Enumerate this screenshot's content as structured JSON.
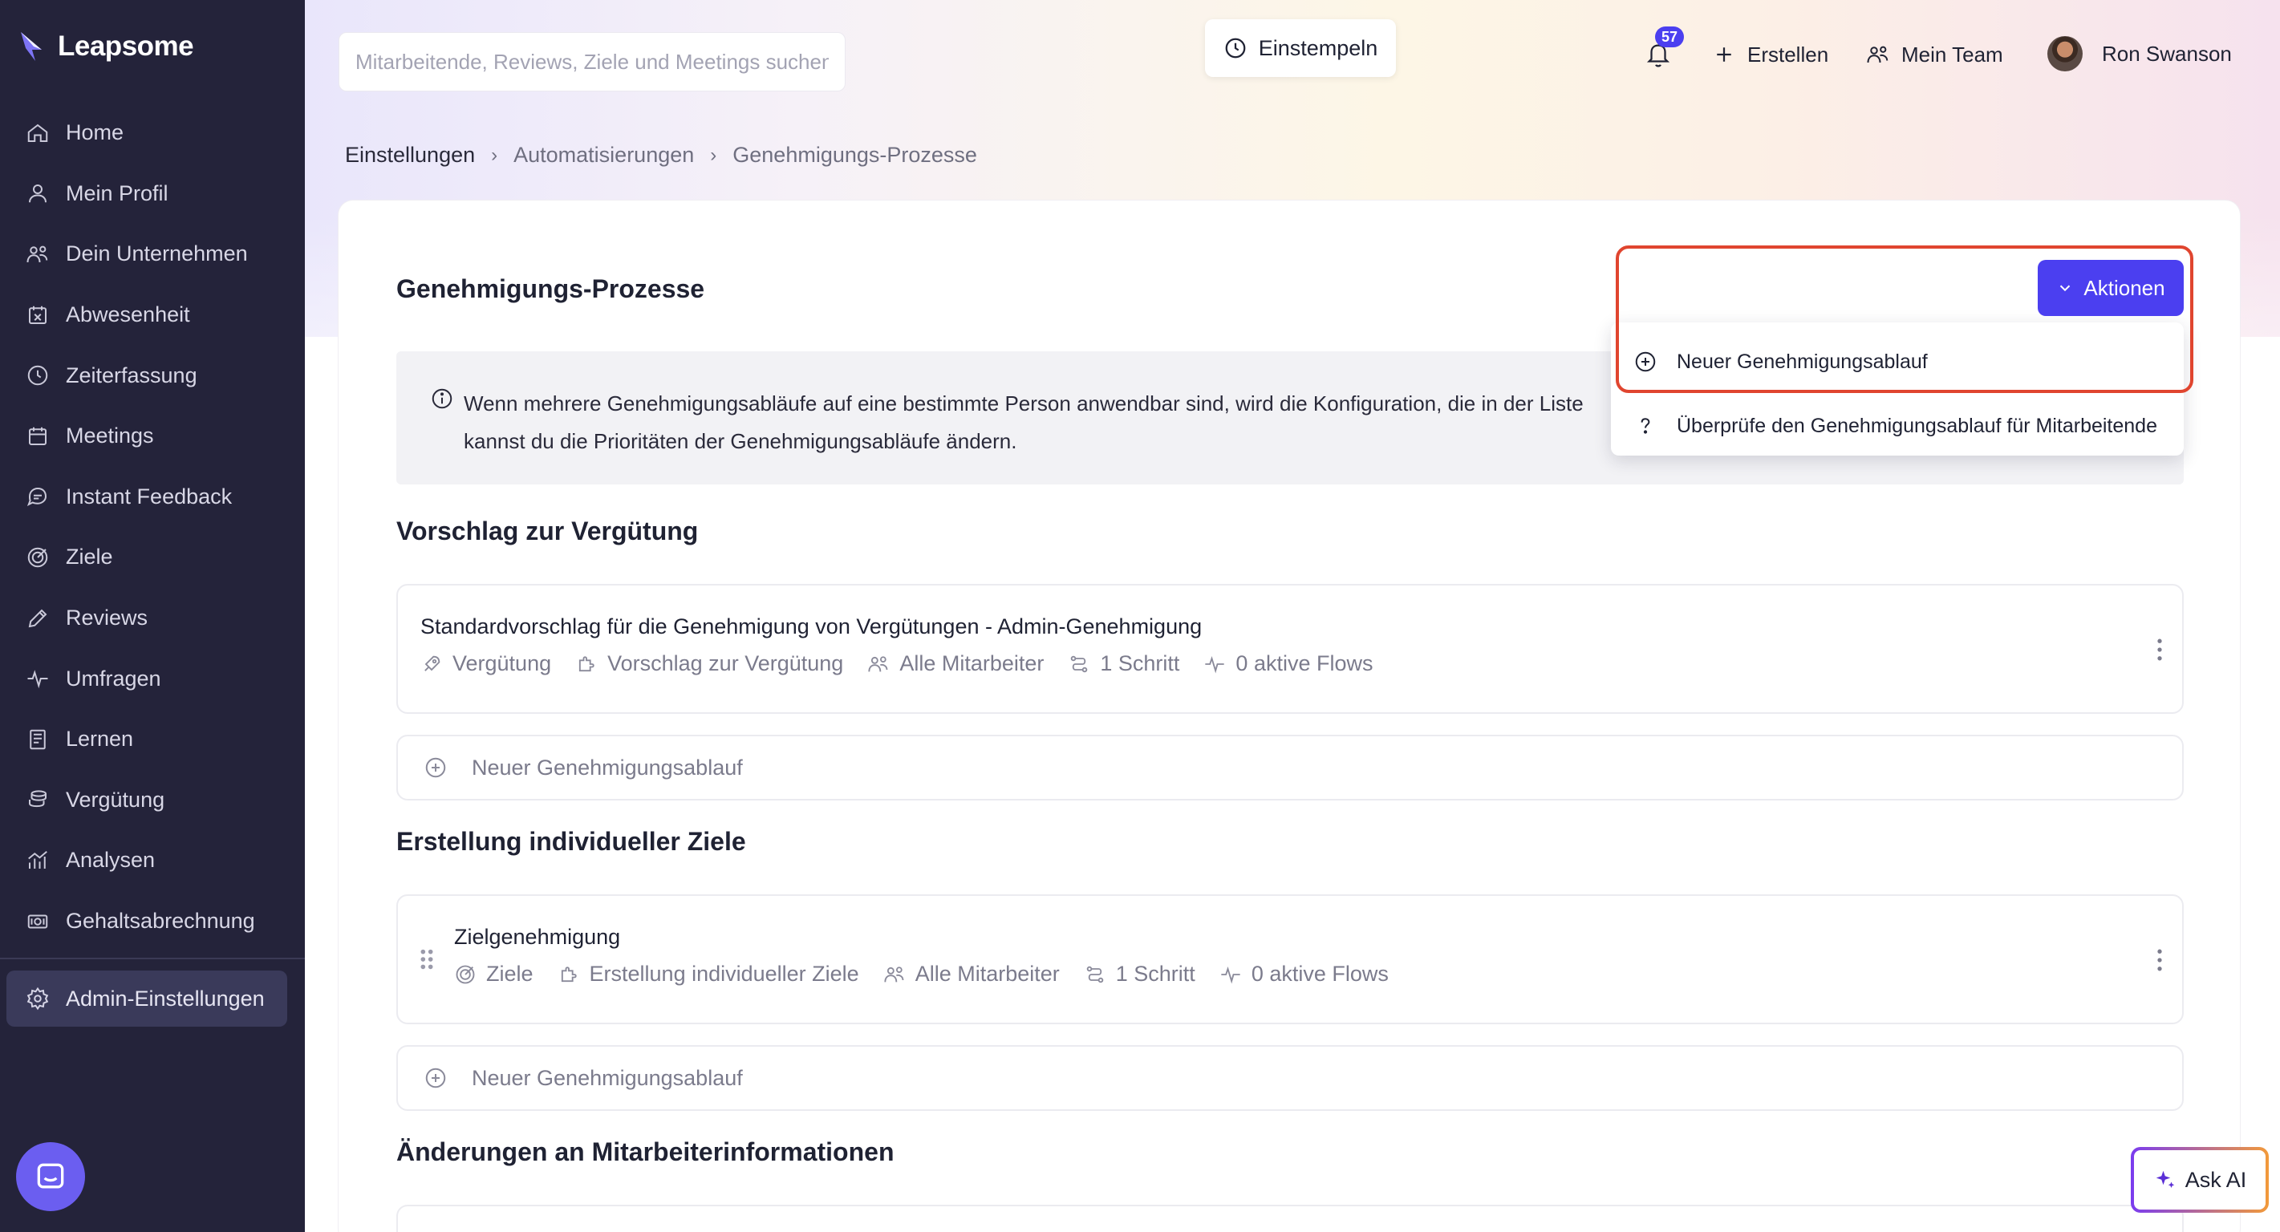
{
  "app": {
    "logo_text": "Leapsome"
  },
  "sidebar": {
    "items": [
      {
        "label": "Home",
        "icon": "home-icon"
      },
      {
        "label": "Mein Profil",
        "icon": "user-icon"
      },
      {
        "label": "Dein Unternehmen",
        "icon": "people-icon"
      },
      {
        "label": "Abwesenheit",
        "icon": "calendar-x-icon"
      },
      {
        "label": "Zeiterfassung",
        "icon": "clock-icon"
      },
      {
        "label": "Meetings",
        "icon": "calendar-icon"
      },
      {
        "label": "Instant Feedback",
        "icon": "chat-icon"
      },
      {
        "label": "Ziele",
        "icon": "target-icon"
      },
      {
        "label": "Reviews",
        "icon": "pencil-icon"
      },
      {
        "label": "Umfragen",
        "icon": "pulse-icon"
      },
      {
        "label": "Lernen",
        "icon": "book-icon"
      },
      {
        "label": "Vergütung",
        "icon": "coins-icon"
      },
      {
        "label": "Analysen",
        "icon": "chart-icon"
      },
      {
        "label": "Gehaltsabrechnung",
        "icon": "money-icon"
      }
    ],
    "admin": {
      "label": "Admin-Einstellungen",
      "icon": "gear-icon"
    }
  },
  "header": {
    "search_placeholder": "Mitarbeitende, Reviews, Ziele und Meetings suchen",
    "clock_in": "Einstempeln",
    "notifications_count": "57",
    "create": "Erstellen",
    "my_team": "Mein Team",
    "user_name": "Ron Swanson"
  },
  "breadcrumb": [
    "Einstellungen",
    "Automatisierungen",
    "Genehmigungs-Prozesse"
  ],
  "page": {
    "title": "Genehmigungs-Prozesse",
    "actions_label": "Aktionen",
    "info_line1": "Wenn mehrere Genehmigungsabläufe auf eine bestimmte Person anwendbar sind, wird die Konfiguration, die in der Liste",
    "info_line2": "kannst du die Prioritäten der Genehmigungsabläufe ändern."
  },
  "dropdown": {
    "items": [
      {
        "label": "Neuer Genehmigungsablauf",
        "icon": "plus-circle-icon"
      },
      {
        "label": "Überprüfe den Genehmigungsablauf für Mitarbeitende",
        "icon": "question-icon"
      }
    ]
  },
  "sections": [
    {
      "title": "Vorschlag zur Vergütung",
      "flow": {
        "name": "Standardvorschlag für die Genehmigung von Vergütungen - Admin-Genehmigung",
        "meta": [
          "Vergütung",
          "Vorschlag zur Vergütung",
          "Alle Mitarbeiter",
          "1 Schritt",
          "0 aktive Flows"
        ]
      },
      "add_label": "Neuer Genehmigungsablauf"
    },
    {
      "title": "Erstellung individueller Ziele",
      "flow": {
        "name": "Zielgenehmigung",
        "meta": [
          "Ziele",
          "Erstellung individueller Ziele",
          "Alle Mitarbeiter",
          "1 Schritt",
          "0 aktive Flows"
        ]
      },
      "add_label": "Neuer Genehmigungsablauf"
    },
    {
      "title": "Änderungen an Mitarbeiterinformationen"
    }
  ],
  "ask_ai": "Ask AI",
  "colors": {
    "sidebar_bg": "#24233a",
    "primary": "#4b3ff0",
    "highlight": "#e0452f"
  }
}
